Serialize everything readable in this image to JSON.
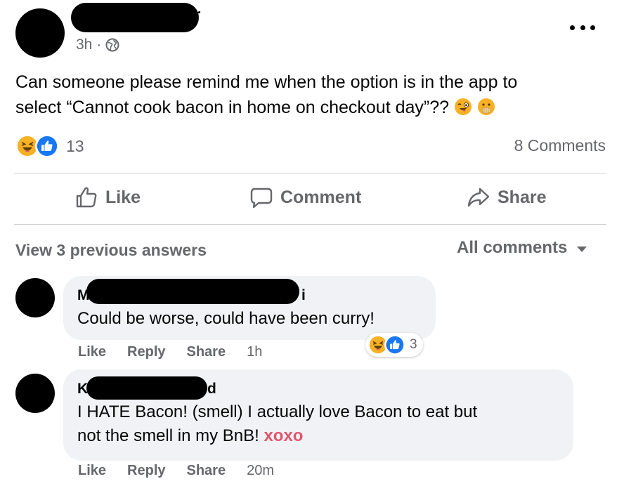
{
  "post": {
    "author_visible_suffix": "r",
    "time": "3h",
    "separator": "·",
    "text_lines": [
      "Can someone please remind me when the option is in the app to",
      "select “Cannot cook bacon in home on checkout day”??"
    ],
    "reaction_count": "13",
    "comment_count": "8 Comments",
    "reaction_icons": [
      "laughing-emoji",
      "like-thumb"
    ],
    "trailing_emojis": [
      "winking-face-emoji",
      "face-with-hand-over-mouth-emoji"
    ]
  },
  "actions": {
    "like": "Like",
    "comment": "Comment",
    "share": "Share"
  },
  "comments_header": {
    "view_previous": "View 3 previous answers",
    "filter": "All comments"
  },
  "comments": [
    {
      "name_start": "M",
      "name_end": "i",
      "text": "Could be worse, could have been curry!",
      "like": "Like",
      "reply": "Reply",
      "share": "Share",
      "time": "1h",
      "reaction_count": "3"
    },
    {
      "name_start": "K",
      "name_end": "d",
      "text_line1": "I HATE Bacon! (smell) I actually love Bacon to eat but",
      "text_line2": "not the smell in my BnB!",
      "sign_off": "xoxo",
      "like": "Like",
      "reply": "Reply",
      "share": "Share",
      "time": "20m"
    }
  ],
  "colors": {
    "text": "#050505",
    "secondary": "#65676b",
    "like_blue": "#1877f2",
    "emoji_yellow": "#f7b125",
    "xoxo_pink": "#e0566c",
    "bubble_bg": "#f0f2f5",
    "divider": "#ced0d4"
  }
}
